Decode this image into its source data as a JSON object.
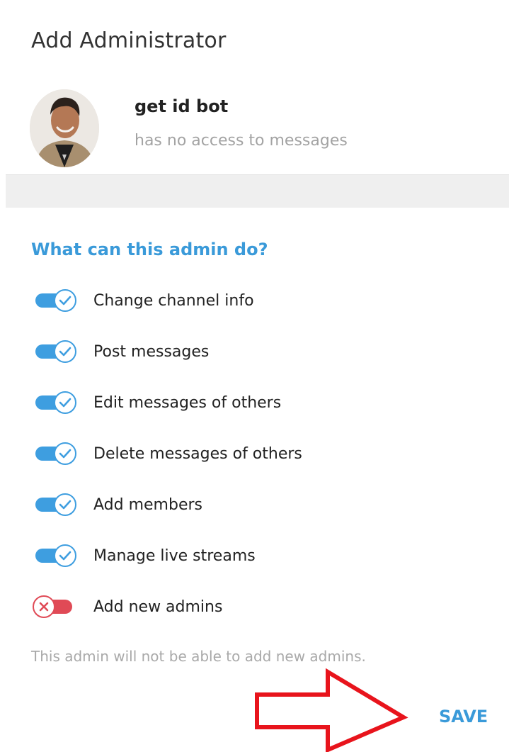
{
  "dialog": {
    "title": "Add Administrator",
    "save_label": "SAVE"
  },
  "bot": {
    "name": "get id bot",
    "status": "has no access to messages"
  },
  "permissions": {
    "section_title": "What can this admin do?",
    "items": [
      {
        "label": "Change channel info",
        "enabled": true
      },
      {
        "label": "Post messages",
        "enabled": true
      },
      {
        "label": "Edit messages of others",
        "enabled": true
      },
      {
        "label": "Delete messages of others",
        "enabled": true
      },
      {
        "label": "Add members",
        "enabled": true
      },
      {
        "label": "Manage live streams",
        "enabled": true
      },
      {
        "label": "Add new admins",
        "enabled": false
      }
    ],
    "hint": "This admin will not be able to add new admins."
  },
  "colors": {
    "accent": "#3a9ad9",
    "toggle_on": "#3e9ee0",
    "toggle_off": "#e04a56",
    "annotation_arrow": "#e8141c"
  }
}
